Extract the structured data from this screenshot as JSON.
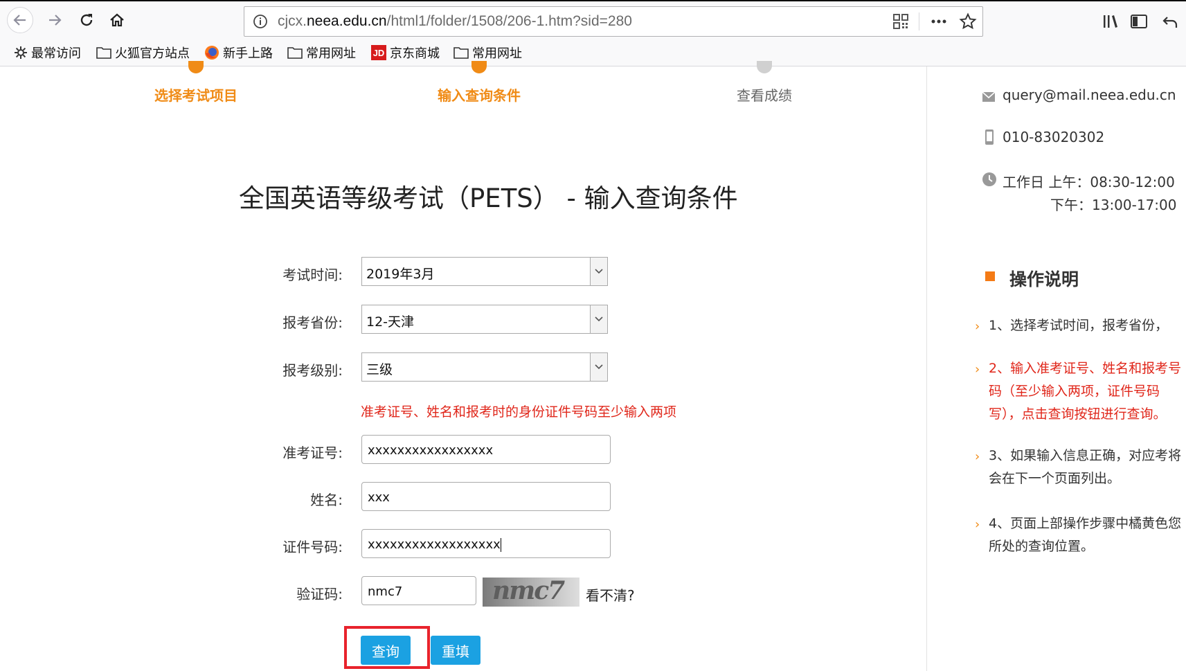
{
  "browser": {
    "url_prefix": "cjcx.",
    "url_domain": "neea.edu.cn",
    "url_path": "/html1/folder/1508/206-1.htm?sid=280",
    "bookmarks": [
      "最常访问",
      "火狐官方站点",
      "新手上路",
      "常用网址",
      "京东商城",
      "常用网址"
    ]
  },
  "steps": [
    {
      "label": "选择考试项目",
      "state": "done"
    },
    {
      "label": "输入查询条件",
      "state": "current"
    },
    {
      "label": "查看成绩",
      "state": "pending"
    }
  ],
  "page_title": "全国英语等级考试（PETS） - 输入查询条件",
  "form": {
    "exam_time": {
      "label": "考试时间:",
      "value": "2019年3月"
    },
    "province": {
      "label": "报考省份:",
      "value": "12-天津"
    },
    "level": {
      "label": "报考级别:",
      "value": "三级"
    },
    "hint": "准考证号、姓名和报考时的身份证件号码至少输入两项",
    "ticket_no": {
      "label": "准考证号:",
      "value": "xxxxxxxxxxxxxxxxx"
    },
    "name": {
      "label": "姓名:",
      "value": "xxx"
    },
    "id_no": {
      "label": "证件号码:",
      "value": "xxxxxxxxxxxxxxxxxx"
    },
    "captcha": {
      "label": "验证码:",
      "value": "nmc7",
      "image_text": "nmc7",
      "refresh_label": "看不清?"
    },
    "submit_label": "查询",
    "reset_label": "重填"
  },
  "sidebar": {
    "email": "query@mail.neea.edu.cn",
    "phone": "010-83020302",
    "hours_line1": "工作日 上午：08:30-12:00",
    "hours_line2": "下午：13:00-17:00",
    "help_title": "操作说明",
    "help_items": [
      {
        "text": "1、选择考试时间，报考省份，",
        "highlight": false
      },
      {
        "text": "2、输入准考证号、姓名和报考号码（至少输入两项，证件号码写），点击查询按钮进行查询。",
        "highlight": true
      },
      {
        "text": "3、如果输入信息正确，对应考将会在下一个页面列出。",
        "highlight": false
      },
      {
        "text": "4、页面上部操作步骤中橘黄色您所处的查询位置。",
        "highlight": false
      }
    ]
  },
  "colors": {
    "accent_orange": "#f08b16",
    "button_blue": "#1ba1e2",
    "error_red": "#e0261a",
    "highlight_box": "#e8232c"
  }
}
